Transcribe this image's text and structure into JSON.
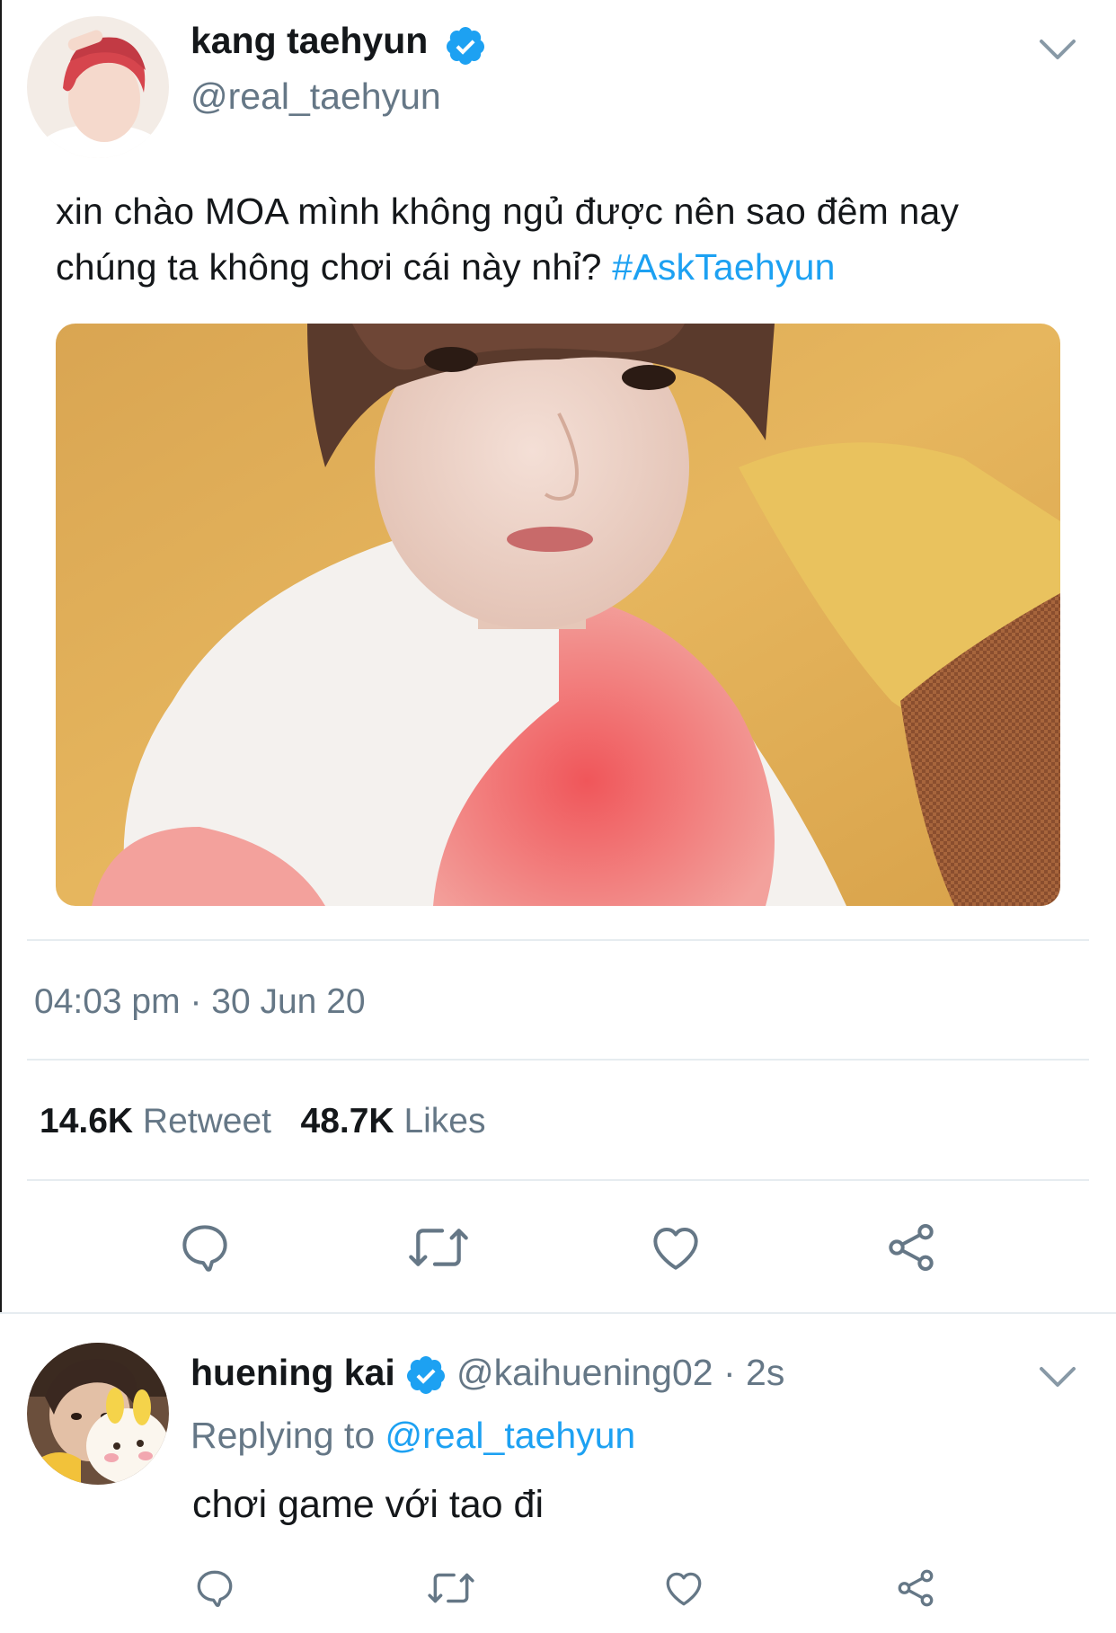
{
  "tweet": {
    "author_name": "kang taehyun",
    "author_handle": "@real_taehyun",
    "text_line1": "xin chào MOA mình không ngủ được nên sao đêm nay",
    "text_line2": "chúng ta không chơi cái này nhỉ?",
    "hashtag": "#AskTaehyun",
    "timestamp": "04:03 pm · 30 Jun 20",
    "retweet_count": "14.6K",
    "retweet_label": "Retweet",
    "like_count": "48.7K",
    "like_label": "Likes"
  },
  "reply": {
    "author_name": "huening kai",
    "author_handle": "@kaihuening02",
    "time": "· 2s",
    "replying_prefix": "Replying to",
    "replying_to": "@real_taehyun",
    "text": "chơi game với tao đi"
  },
  "icons": {
    "verified": "verified-badge-icon",
    "more": "chevron-down-icon",
    "reply": "comment-icon",
    "retweet": "retweet-icon",
    "like": "heart-icon",
    "share": "share-icon"
  },
  "colors": {
    "accent": "#1da1f2",
    "muted": "#657786",
    "text": "#14171a",
    "divider": "#e6ecf0"
  }
}
